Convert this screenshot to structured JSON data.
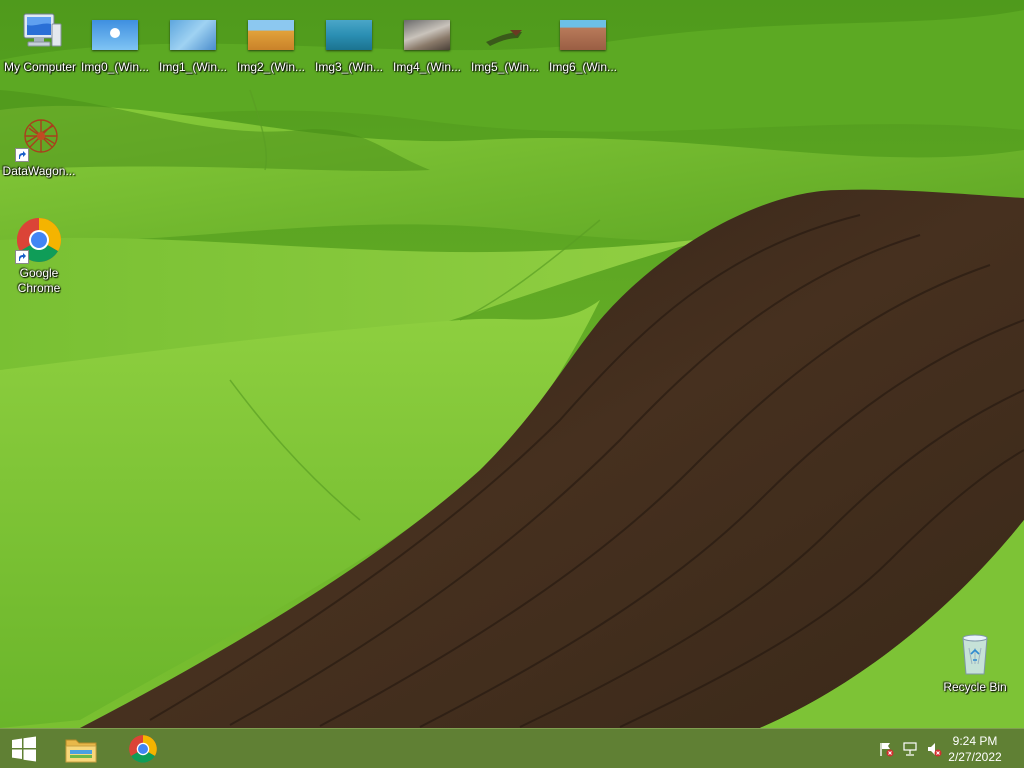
{
  "desktop": {
    "icons": [
      {
        "label": "My Computer",
        "icon": "my-computer-icon"
      },
      {
        "label": "Img0_(Win...",
        "icon": "image-thumbnail-icon"
      },
      {
        "label": "Img1_(Win...",
        "icon": "image-thumbnail-icon"
      },
      {
        "label": "Img2_(Win...",
        "icon": "image-thumbnail-icon"
      },
      {
        "label": "Img3_(Win...",
        "icon": "image-thumbnail-icon"
      },
      {
        "label": "Img4_(Win...",
        "icon": "image-thumbnail-icon"
      },
      {
        "label": "Img5_(Win...",
        "icon": "image-thumbnail-icon"
      },
      {
        "label": "Img6_(Win...",
        "icon": "image-thumbnail-icon"
      },
      {
        "label": "DataWagon...",
        "icon": "datawagon-shortcut-icon"
      },
      {
        "label": "Google Chrome",
        "icon": "chrome-shortcut-icon"
      },
      {
        "label": "Recycle Bin",
        "icon": "recycle-bin-icon"
      }
    ]
  },
  "taskbar": {
    "start_icon": "windows-logo-icon",
    "pinned": [
      {
        "icon": "file-explorer-icon"
      },
      {
        "icon": "chrome-icon"
      }
    ],
    "tray": {
      "icons": [
        "action-center-flag-icon",
        "network-icon",
        "volume-muted-icon"
      ],
      "time": "9:24 PM",
      "date": "2/27/2022"
    }
  },
  "colors": {
    "grass": "#6fb52c",
    "soil": "#3d2b1e",
    "taskbar": "#5c7634"
  }
}
